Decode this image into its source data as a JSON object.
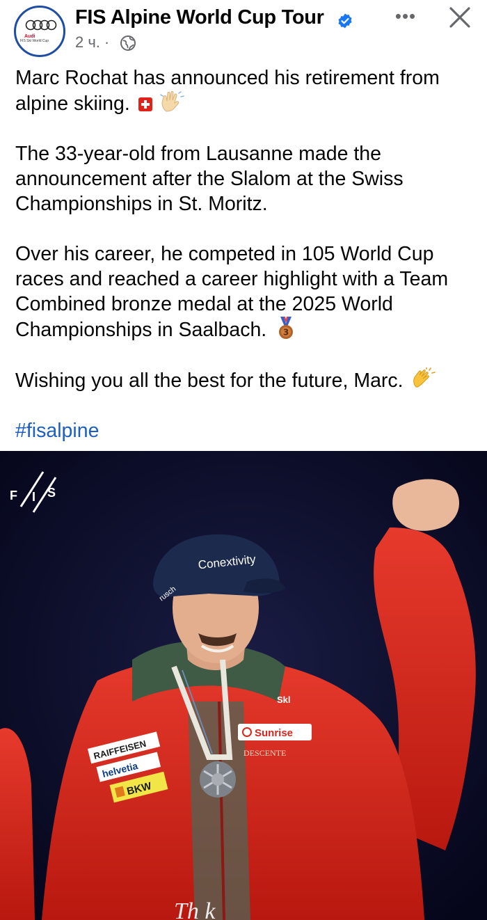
{
  "header": {
    "page_name": "FIS Alpine World Cup Tour",
    "time": "2 ч.",
    "dot": "·",
    "avatar": {
      "brand": "Audi",
      "sub": "FIS Ski World Cup"
    },
    "more_label": "•••"
  },
  "post": {
    "line1": "Marc Rochat has announced his retirement from alpine skiing.",
    "para2": "The 33-year-old from Lausanne made the announcement after the Slalom at the Swiss Championships in St. Moritz.",
    "para3": "Over his career, he competed in 105 World Cup races and reached a career highlight with a Team Combined bronze medal at the 2025 World Championships in Saalbach.",
    "para4": "Wishing you all the best for the future, Marc.",
    "hashtag": "#fisalpine",
    "icons": [
      "swiss-flag-emoji",
      "waving-hand-emoji",
      "bronze-medal-emoji",
      "clapping-hands-emoji"
    ]
  },
  "photo": {
    "fis_logo": "F/I/S",
    "cap_text": "Conextivity",
    "cap_side": "rusch",
    "sponsor1": "RAIFFEISEN",
    "sponsor2": "helvetia",
    "sponsor3": "BKW",
    "sponsor4": "Sunrise",
    "sponsor5": "DESCENTE",
    "sponsor6": "Skl",
    "caption_partial": "Th    k",
    "colors": {
      "background": "#0c0d2a",
      "jacket": "#d9261c",
      "collar": "#3f5a45"
    }
  },
  "colors": {
    "text": "#050505",
    "meta": "#65676b",
    "hashtag": "#1d5fbf",
    "verified": "#1877f2"
  }
}
